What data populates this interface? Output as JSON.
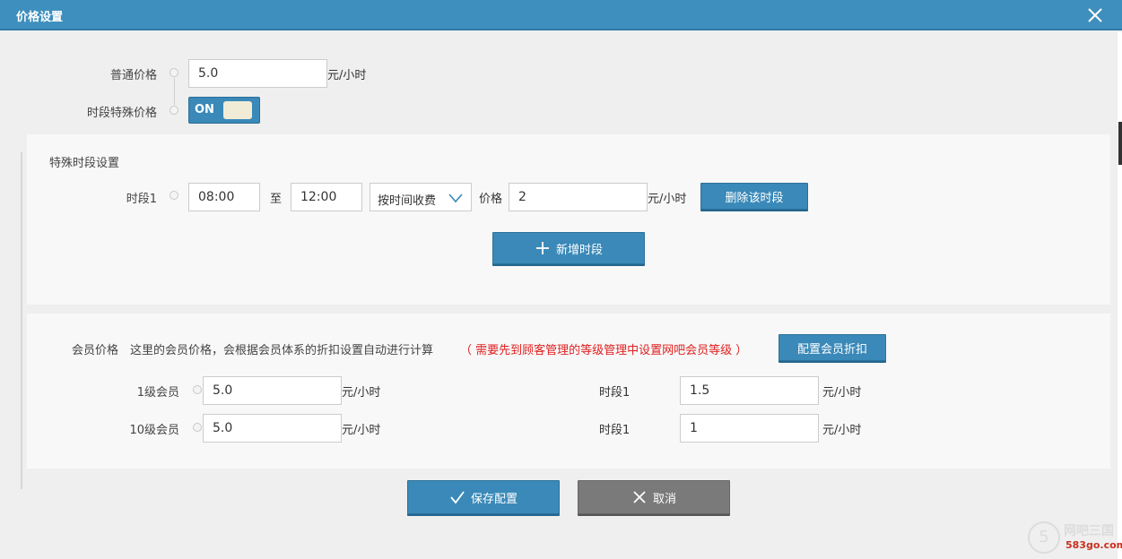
{
  "window": {
    "title": "价格设置"
  },
  "normal_price": {
    "label": "普通价格",
    "value": "5.0",
    "unit": "元/小时"
  },
  "special_toggle": {
    "label": "时段特殊价格",
    "state": "ON"
  },
  "special_section": {
    "heading": "特殊时段设置",
    "period": {
      "label": "时段1",
      "start": "08:00",
      "to": "至",
      "end": "12:00",
      "mode": "按时间收费",
      "price_label": "价格",
      "price": "2",
      "unit": "元/小时",
      "delete_label": "删除该时段"
    },
    "add_label": "新增时段"
  },
  "member_section": {
    "label": "会员价格",
    "desc": "这里的会员价格，会根据会员体系的折扣设置自动进行计算",
    "warning": "（ 需要先到顾客管理的等级管理中设置网吧会员等级 ）",
    "config_label": "配置会员折扣",
    "rows": [
      {
        "level": "1级会员",
        "price": "5.0",
        "unit": "元/小时",
        "period": "时段1",
        "period_price": "1.5",
        "period_unit": "元/小时"
      },
      {
        "level": "10级会员",
        "price": "5.0",
        "unit": "元/小时",
        "period": "时段1",
        "period_price": "1",
        "period_unit": "元/小时"
      }
    ]
  },
  "footer": {
    "save_label": "保存配置",
    "cancel_label": "取消"
  },
  "watermark": {
    "symbol": "5",
    "name": "网吧三国",
    "site": "583go.com"
  },
  "colors": {
    "accent": "#3a89b8",
    "titlebar": "#3e8fbd",
    "warning": "#e02020",
    "cancel": "#7a7a7a"
  }
}
